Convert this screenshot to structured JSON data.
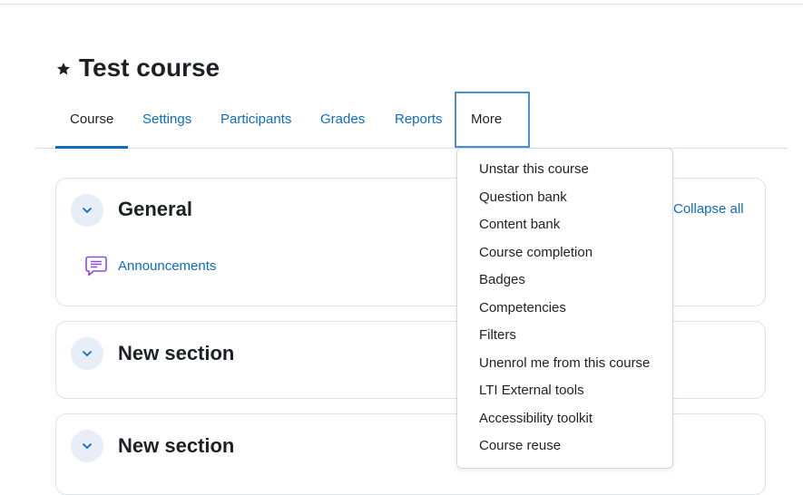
{
  "course": {
    "title": "Test course"
  },
  "nav": {
    "tabs": [
      "Course",
      "Settings",
      "Participants",
      "Grades",
      "Reports"
    ],
    "more_label": "More"
  },
  "toolbar": {
    "collapse_all": "Collapse all"
  },
  "sections": [
    {
      "title": "General",
      "activities": [
        {
          "label": "Announcements",
          "icon": "forum-icon"
        }
      ]
    },
    {
      "title": "New section"
    },
    {
      "title": "New section"
    }
  ],
  "more_menu": {
    "items": [
      "Unstar this course",
      "Question bank",
      "Content bank",
      "Course completion",
      "Badges",
      "Competencies",
      "Filters",
      "Unenrol me from this course",
      "LTI External tools",
      "Accessibility toolkit",
      "Course reuse"
    ]
  },
  "colors": {
    "link": "#0f6cbf",
    "text": "#1d2125",
    "toggle_bg": "#e7eef8",
    "activity_icon": "#8a4fd8"
  }
}
